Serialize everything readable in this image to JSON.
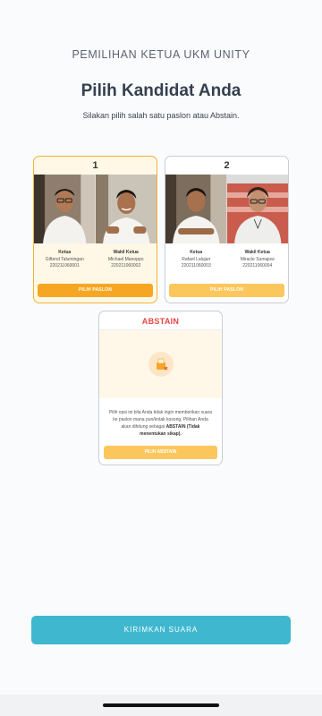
{
  "header": {
    "eyebrow": "PEMILIHAN KETUA UKM UNITY",
    "title": "Pilih Kandidat Anda",
    "subtitle": "Silakan pilih salah satu paslon atau Abstain."
  },
  "candidates": [
    {
      "number": "1",
      "selected": true,
      "ketua": {
        "role": "Ketua",
        "name": "Giftend Talumingan",
        "id": "220211060001"
      },
      "wakil": {
        "role": "Wakil Ketua",
        "name": "Michael Manoppo",
        "id": "220211060002"
      },
      "button_label": "PILIH PASLON"
    },
    {
      "number": "2",
      "selected": false,
      "ketua": {
        "role": "Ketua",
        "name": "Rafael Lalujan",
        "id": "220211060003"
      },
      "wakil": {
        "role": "Wakil Ketua",
        "name": "Miracle Sumajow",
        "id": "220211060004"
      },
      "button_label": "PILIH PASLON"
    }
  ],
  "abstain": {
    "title": "ABSTAIN",
    "icon": "ballot-box-x-icon",
    "desc_before": "Pilih opsi ini bila Anda tidak ingin memberikan suara ke paslon mana pun/kotak kosong. Pilihan Anda akan dihitung sebagai ",
    "desc_bold": "ABSTAIN (Tidak menentukan sikap).",
    "button_label": "PILIH ABSTAIN"
  },
  "submit_label": "KIRIMKAN SUARA",
  "colors": {
    "accent_orange": "#f6a623",
    "accent_orange_light": "#fbc65c",
    "submit_teal": "#3fb8cf",
    "abstain_red": "#e64545"
  }
}
